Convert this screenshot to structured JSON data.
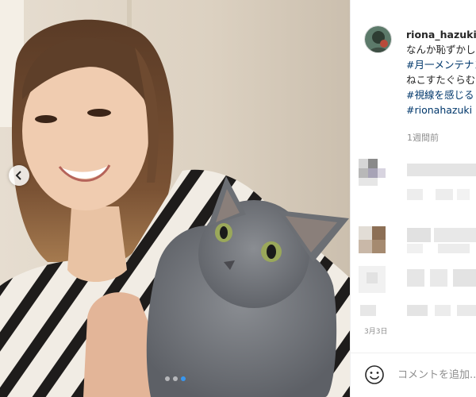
{
  "post": {
    "username": "riona_hazuki",
    "caption_lines": [
      "なんか恥ずかしい"
    ],
    "hashtags": [
      "#月一メンテナンス",
      "ねこすたぐらむ",
      "#視線を感じる",
      "#rionahazuki"
    ],
    "time_ago": "1週間前"
  },
  "comments_date": "3月3日",
  "comment_box": {
    "placeholder": "コメントを追加..."
  },
  "carousel": {
    "slide_count": 3,
    "active_index": 2
  },
  "colors": {
    "accent": "#3897f0",
    "hashtag": "#00376b",
    "muted": "#8e8e8e"
  },
  "icons": {
    "carousel_prev": "chevron-left-icon",
    "emoji": "smiley-icon"
  }
}
